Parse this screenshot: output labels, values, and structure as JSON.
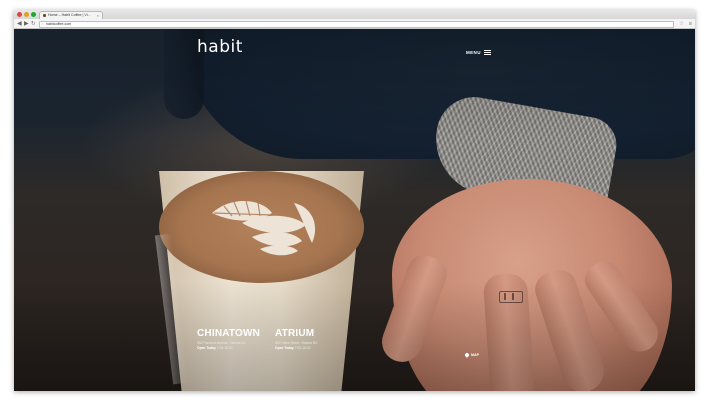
{
  "browser": {
    "tab_title": "Home – Habit Coffee | Vi...",
    "url": "habitcoffee.com",
    "tab_close": "×",
    "back_glyph": "◀",
    "forward_glyph": "▶",
    "reload_glyph": "↻",
    "star_glyph": "☆",
    "menu_glyph": "≡",
    "lock_glyph": "⌂"
  },
  "site": {
    "logo": "habit",
    "menu_label": "MENU",
    "map_label": "MAP",
    "locations": [
      {
        "name": "CHINATOWN",
        "address": "552 Pandora Avenue, Victoria BC",
        "hours_label": "Open Today",
        "hours": "7:00-18:00"
      },
      {
        "name": "ATRIUM",
        "address": "800 Yates Street, Victoria BC",
        "hours_label": "Open Today",
        "hours": "7:00-18:00"
      }
    ]
  },
  "colors": {
    "overlay_text": "#ffffff",
    "background_dark": "#1c2530"
  }
}
